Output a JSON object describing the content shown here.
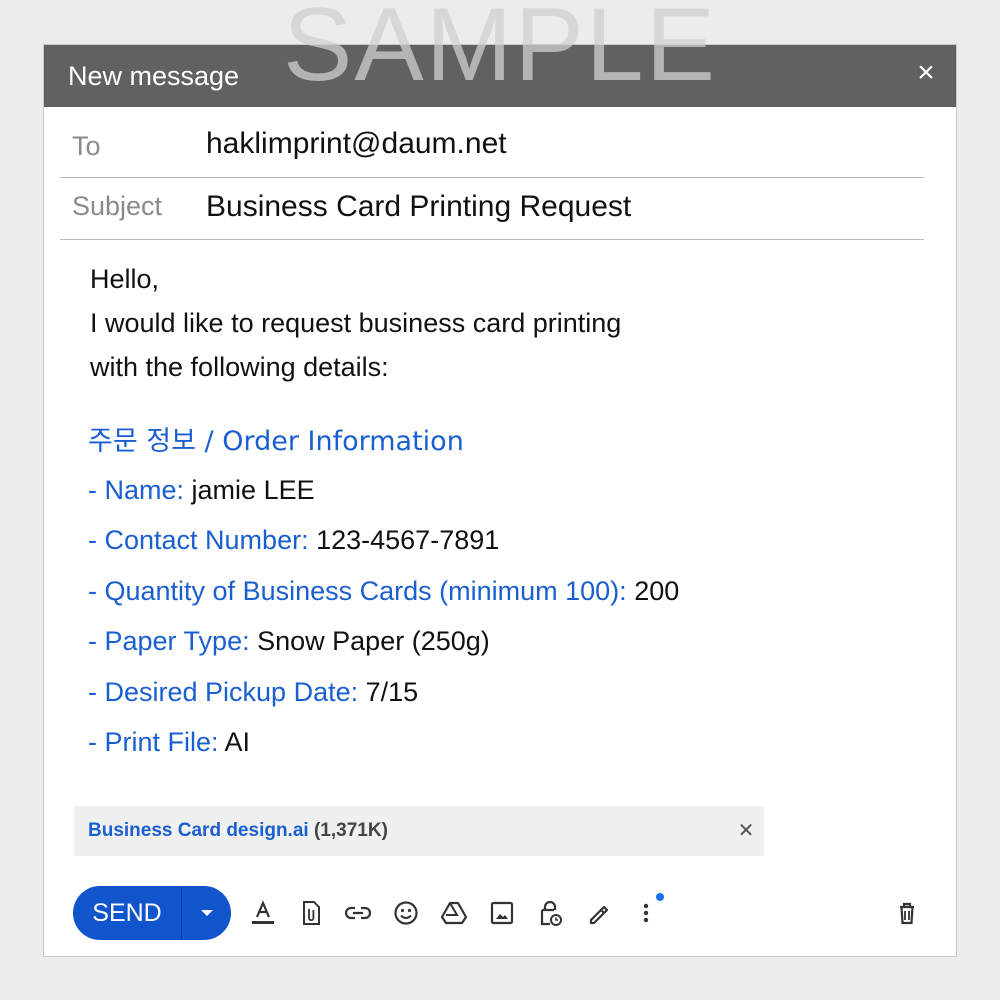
{
  "watermark": "SAMPLE",
  "window": {
    "title": "New message"
  },
  "to": {
    "label": "To",
    "value": "haklimprint@daum.net"
  },
  "subject": {
    "label": "Subject",
    "value": "Business Card Printing Request"
  },
  "body": {
    "line1": "Hello,",
    "line2": "I would like to request business card printing",
    "line3": "with the following details:"
  },
  "order": {
    "heading": "주문 정보 / Order Information",
    "items": [
      {
        "key": "- Name:",
        "value": "jamie LEE"
      },
      {
        "key": "- Contact Number:",
        "value": "123-4567-7891"
      },
      {
        "key": "- Quantity of Business Cards (minimum 100):",
        "value": "200"
      },
      {
        "key": "- Paper Type:",
        "value": "Snow Paper (250g)"
      },
      {
        "key": "- Desired Pickup Date:",
        "value": "7/15"
      },
      {
        "key": "- Print File:",
        "value": "AI"
      }
    ]
  },
  "attachment": {
    "name": "Business Card design.ai",
    "size": "(1,371K)"
  },
  "toolbar": {
    "send_label": "SEND",
    "icons": [
      "format-text-icon",
      "attach-file-icon",
      "insert-link-icon",
      "emoji-icon",
      "drive-icon",
      "insert-photo-icon",
      "confidential-mode-icon",
      "signature-icon",
      "more-options-icon",
      "trash-icon"
    ]
  },
  "colors": {
    "titlebar": "#616161",
    "accent": "#1a5fd0",
    "send_button": "#1155cc"
  }
}
